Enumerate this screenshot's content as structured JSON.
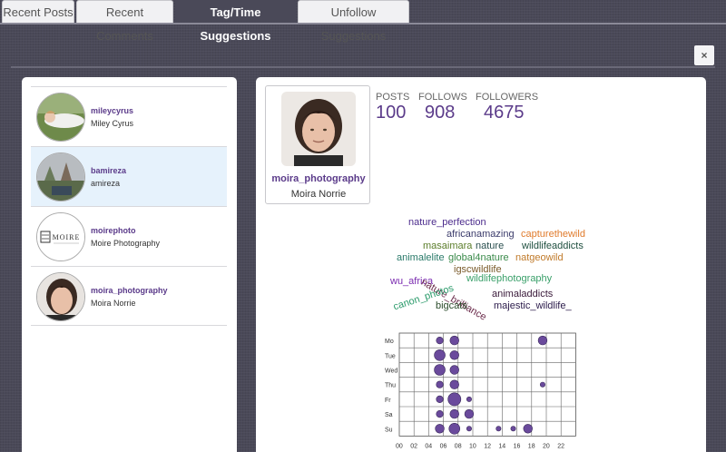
{
  "tabs": [
    {
      "label": "Recent Posts",
      "active": false
    },
    {
      "label": "Recent Comments",
      "active": false
    },
    {
      "label": "Tag/Time Suggestions",
      "active": true
    },
    {
      "label": "Unfollow Suggestions",
      "active": false
    }
  ],
  "close_label": "×",
  "users": [
    {
      "username": "mileycyrus",
      "fullname": "Miley Cyrus",
      "selected": false
    },
    {
      "username": "bamireza",
      "fullname": "amireza",
      "selected": true
    },
    {
      "username": "moirephoto",
      "fullname": "Moire Photography",
      "selected": false,
      "logo_text": "MOIRE"
    },
    {
      "username": "moira_photography",
      "fullname": "Moira Norrie",
      "selected": false
    }
  ],
  "profile": {
    "username": "moira_photography",
    "fullname": "Moira Norrie",
    "stats": {
      "posts_label": "POSTS",
      "posts": "100",
      "follows_label": "FOLLOWS",
      "follows": "908",
      "followers_label": "FOLLOWERS",
      "followers": "4675"
    }
  },
  "tag_cloud": [
    {
      "text": "nature_perfection",
      "color": "#4b2b8c"
    },
    {
      "text": "africanamazing",
      "color": "#3a3a6a"
    },
    {
      "text": "capturethewild",
      "color": "#e07b2c"
    },
    {
      "text": "masaimara",
      "color": "#5b7d2a"
    },
    {
      "text": "nature",
      "color": "#2a4f4f"
    },
    {
      "text": "wildlifeaddicts",
      "color": "#1f4f3f"
    },
    {
      "text": "animalelite",
      "color": "#2a7a6a"
    },
    {
      "text": "global4nature",
      "color": "#3a8a4a"
    },
    {
      "text": "natgeowild",
      "color": "#c07a2a"
    },
    {
      "text": "igscwildlife",
      "color": "#7a5a2a"
    },
    {
      "text": "wu_africa",
      "color": "#7a2ab0"
    },
    {
      "text": "nature_brilliance",
      "color": "#6a2a4a"
    },
    {
      "text": "wildlifephotography",
      "color": "#3aa06a"
    },
    {
      "text": "canon_photos",
      "color": "#2a9a6a"
    },
    {
      "text": "animaladdicts",
      "color": "#3a1a3a"
    },
    {
      "text": "bigcats",
      "color": "#2a4a2a"
    },
    {
      "text": "majestic_wildlife_",
      "color": "#2a1a4a"
    }
  ],
  "chart_data": {
    "type": "heatmap",
    "title": "",
    "rows": [
      "Mo",
      "Tue",
      "Wed",
      "Thu",
      "Fr",
      "Sa",
      "Su"
    ],
    "x_tick_labels": [
      "00",
      "02",
      "04",
      "06",
      "08",
      "10",
      "12",
      "14",
      "16",
      "18",
      "20",
      "22"
    ],
    "x_range": [
      0,
      24
    ],
    "point_color": "#6a4a9c",
    "points": [
      {
        "day": "Mo",
        "hour": 5,
        "size": 2
      },
      {
        "day": "Mo",
        "hour": 7,
        "size": 3
      },
      {
        "day": "Mo",
        "hour": 19,
        "size": 3
      },
      {
        "day": "Tue",
        "hour": 5,
        "size": 4
      },
      {
        "day": "Tue",
        "hour": 7,
        "size": 3
      },
      {
        "day": "Wed",
        "hour": 5,
        "size": 4
      },
      {
        "day": "Wed",
        "hour": 7,
        "size": 3
      },
      {
        "day": "Thu",
        "hour": 5,
        "size": 2
      },
      {
        "day": "Thu",
        "hour": 7,
        "size": 3
      },
      {
        "day": "Thu",
        "hour": 19,
        "size": 1
      },
      {
        "day": "Fr",
        "hour": 5,
        "size": 2
      },
      {
        "day": "Fr",
        "hour": 7,
        "size": 5
      },
      {
        "day": "Fr",
        "hour": 9,
        "size": 1
      },
      {
        "day": "Sa",
        "hour": 5,
        "size": 2
      },
      {
        "day": "Sa",
        "hour": 7,
        "size": 3
      },
      {
        "day": "Sa",
        "hour": 9,
        "size": 3
      },
      {
        "day": "Su",
        "hour": 5,
        "size": 3
      },
      {
        "day": "Su",
        "hour": 7,
        "size": 4
      },
      {
        "day": "Su",
        "hour": 9,
        "size": 1
      },
      {
        "day": "Su",
        "hour": 13,
        "size": 1
      },
      {
        "day": "Su",
        "hour": 15,
        "size": 1
      },
      {
        "day": "Su",
        "hour": 17,
        "size": 3
      }
    ]
  }
}
